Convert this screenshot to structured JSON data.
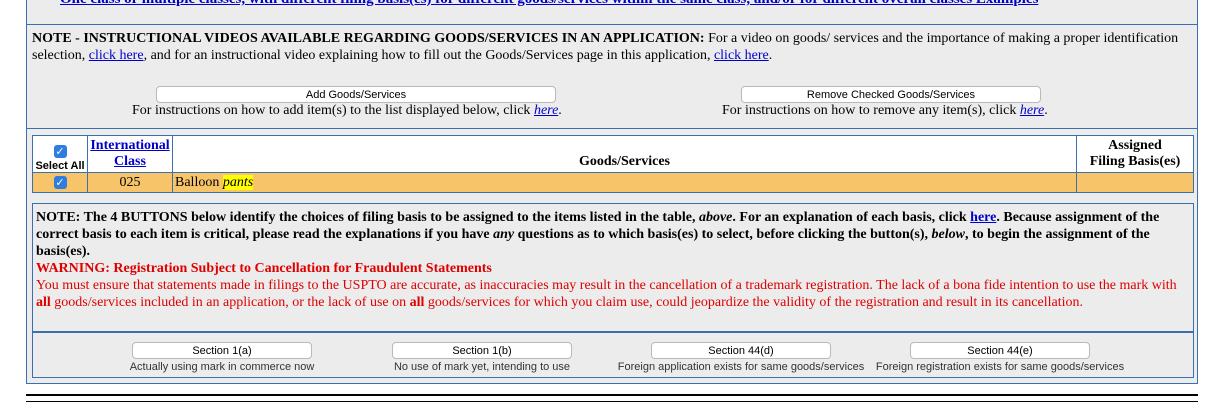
{
  "top_cut_text": "One class or multiple classes, with different filing basis(es) for different goods/services within the same class, and/or for different overall classes   Examples",
  "note1": {
    "bold_lead": "NOTE - INSTRUCTIONAL VIDEOS AVAILABLE REGARDING GOODS/SERVICES IN AN APPLICATION:",
    "text_a": " For a video on goods/ services and the importance of making a proper identification selection, ",
    "link1": "click here",
    "text_b": ", and for an instructional video explaining how to fill out the Goods/Services page in this application, ",
    "link2": "click here",
    "text_c": "."
  },
  "add_button": "Add Goods/Services",
  "add_instr": "For instructions on how to add item(s) to the list displayed below, click ",
  "add_instr_link": "here",
  "remove_button": "Remove Checked Goods/Services",
  "remove_instr": "For instructions on how to remove any item(s), click ",
  "remove_instr_link": "here",
  "table": {
    "select_all": "Select All",
    "col_class_line1": "International",
    "col_class_line2": "Class",
    "col_goods": "Goods/Services",
    "col_basis_line1": "Assigned",
    "col_basis_line2": "Filing Basis(es)",
    "rows": [
      {
        "checked": true,
        "class": "025",
        "goods_plain": "Balloon ",
        "goods_highlight": "pants",
        "basis": ""
      }
    ]
  },
  "note2": {
    "b1": "NOTE: The 4 BUTTONS below identify the choices of filing basis to be assigned to the items listed in the table, ",
    "above": "above",
    "b2": ". For an explanation of each basis, click ",
    "link": "here",
    "b3": ". Because assignment of the correct basis to each item is critical, please read the explanations if you have ",
    "any": "any",
    "b4": " questions as to which basis(es) to select, before clicking the button(s), ",
    "below": "below",
    "b5": ", to begin the assignment of the basis(es).",
    "warning_title": "WARNING: Registration Subject to Cancellation for Fraudulent Statements",
    "w1": "You must ensure that statements made in filings to the USPTO are accurate, as inaccuracies may result in the cancellation of a trademark registration. The lack of a bona fide intention to use the mark with ",
    "all1": "all",
    "w2": " goods/services included in an application, or the lack of use on ",
    "all2": "all",
    "w3": " goods/services for which you claim use, could jeopardize the validity of the registration and result in its cancellation."
  },
  "basis_buttons": [
    {
      "label": "Section 1(a)",
      "desc": "Actually using mark in commerce now"
    },
    {
      "label": "Section 1(b)",
      "desc": "No use of mark yet, intending to use"
    },
    {
      "label": "Section 44(d)",
      "desc": "Foreign application exists for same goods/services"
    },
    {
      "label": "Section 44(e)",
      "desc": "Foreign registration exists for same goods/services"
    }
  ]
}
